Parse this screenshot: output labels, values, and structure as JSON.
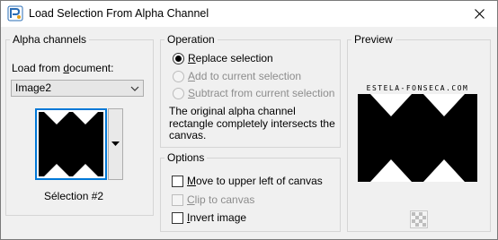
{
  "window": {
    "title": "Load Selection From Alpha Channel"
  },
  "alpha_channels": {
    "group_title": "Alpha channels",
    "load_from_label_pre": "Load from ",
    "load_from_label_u": "d",
    "load_from_label_post": "ocument:",
    "document_value": "Image2",
    "thumbnail_caption": "Sélection #2"
  },
  "operation": {
    "group_title": "Operation",
    "options": [
      {
        "u": "R",
        "rest": "eplace selection",
        "checked": true,
        "enabled": true
      },
      {
        "u": "A",
        "rest": "dd to current selection",
        "checked": false,
        "enabled": false
      },
      {
        "u": "S",
        "rest": "ubtract from current selection",
        "checked": false,
        "enabled": false
      }
    ],
    "description": "The original alpha channel rectangle completely intersects the canvas."
  },
  "options": {
    "group_title": "Options",
    "items": [
      {
        "u": "M",
        "rest": "ove to upper left of canvas",
        "checked": false,
        "enabled": true
      },
      {
        "u": "C",
        "rest": "lip to canvas",
        "checked": false,
        "enabled": false
      },
      {
        "u": "I",
        "rest": "nvert image",
        "checked": false,
        "enabled": true
      }
    ]
  },
  "preview": {
    "group_title": "Preview",
    "caption": "ESTELA-FONSECA.COM"
  },
  "icons": {
    "app": "paintshop-app-icon",
    "close": "close-icon",
    "dropdown": "chevron-down-icon",
    "zoom": "checkerboard-zoom-icon"
  },
  "colors": {
    "accent": "#0078d7",
    "group_border": "#d5d5d5",
    "preview_fill": "#000000"
  }
}
